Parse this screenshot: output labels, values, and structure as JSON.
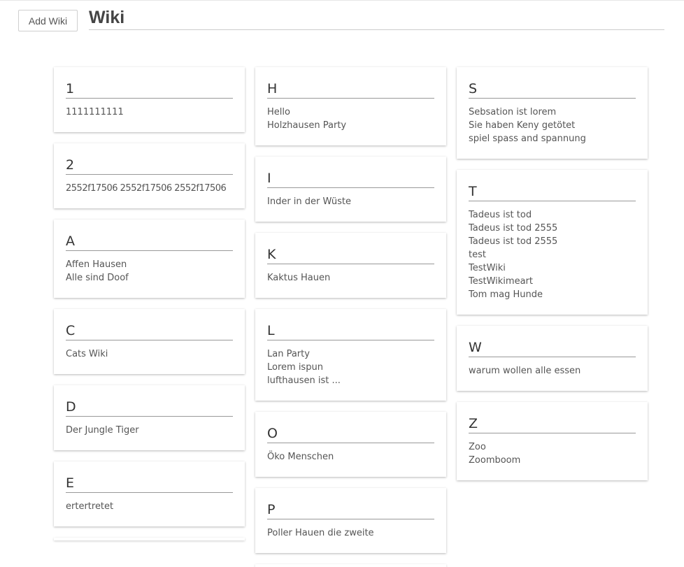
{
  "header": {
    "add_button_label": "Add Wiki",
    "title": "Wiki"
  },
  "columns": [
    [
      {
        "letter": "1",
        "items": [
          "1111111111"
        ]
      },
      {
        "letter": "2",
        "items": [
          "2552f17506 2552f17506 2552f17506"
        ]
      },
      {
        "letter": "A",
        "items": [
          "Affen Hausen",
          "Alle sind Doof"
        ]
      },
      {
        "letter": "C",
        "items": [
          "Cats Wiki"
        ]
      },
      {
        "letter": "D",
        "items": [
          "Der Jungle Tiger"
        ]
      },
      {
        "letter": "E",
        "items": [
          "ertertretet"
        ]
      }
    ],
    [
      {
        "letter": "H",
        "items": [
          "Hello",
          "Holzhausen Party"
        ]
      },
      {
        "letter": "I",
        "items": [
          "Inder in der Wüste"
        ]
      },
      {
        "letter": "K",
        "items": [
          "Kaktus Hauen"
        ]
      },
      {
        "letter": "L",
        "items": [
          "Lan Party",
          "Lorem ispun",
          "lufthausen ist ..."
        ]
      },
      {
        "letter": "O",
        "items": [
          "Öko Menschen"
        ]
      },
      {
        "letter": "P",
        "items": [
          "Poller Hauen die zweite"
        ]
      }
    ],
    [
      {
        "letter": "S",
        "items": [
          "Sebsation ist lorem",
          "Sie haben Keny getötet",
          "spiel spass and spannung"
        ]
      },
      {
        "letter": "T",
        "items": [
          "Tadeus ist tod",
          "Tadeus ist tod 2555",
          "Tadeus ist tod 2555",
          "test",
          "TestWiki",
          "TestWikimeart",
          "Tom mag Hunde"
        ]
      },
      {
        "letter": "W",
        "items": [
          "warum wollen alle essen"
        ]
      },
      {
        "letter": "Z",
        "items": [
          "Zoo",
          "Zoomboom"
        ]
      }
    ]
  ]
}
